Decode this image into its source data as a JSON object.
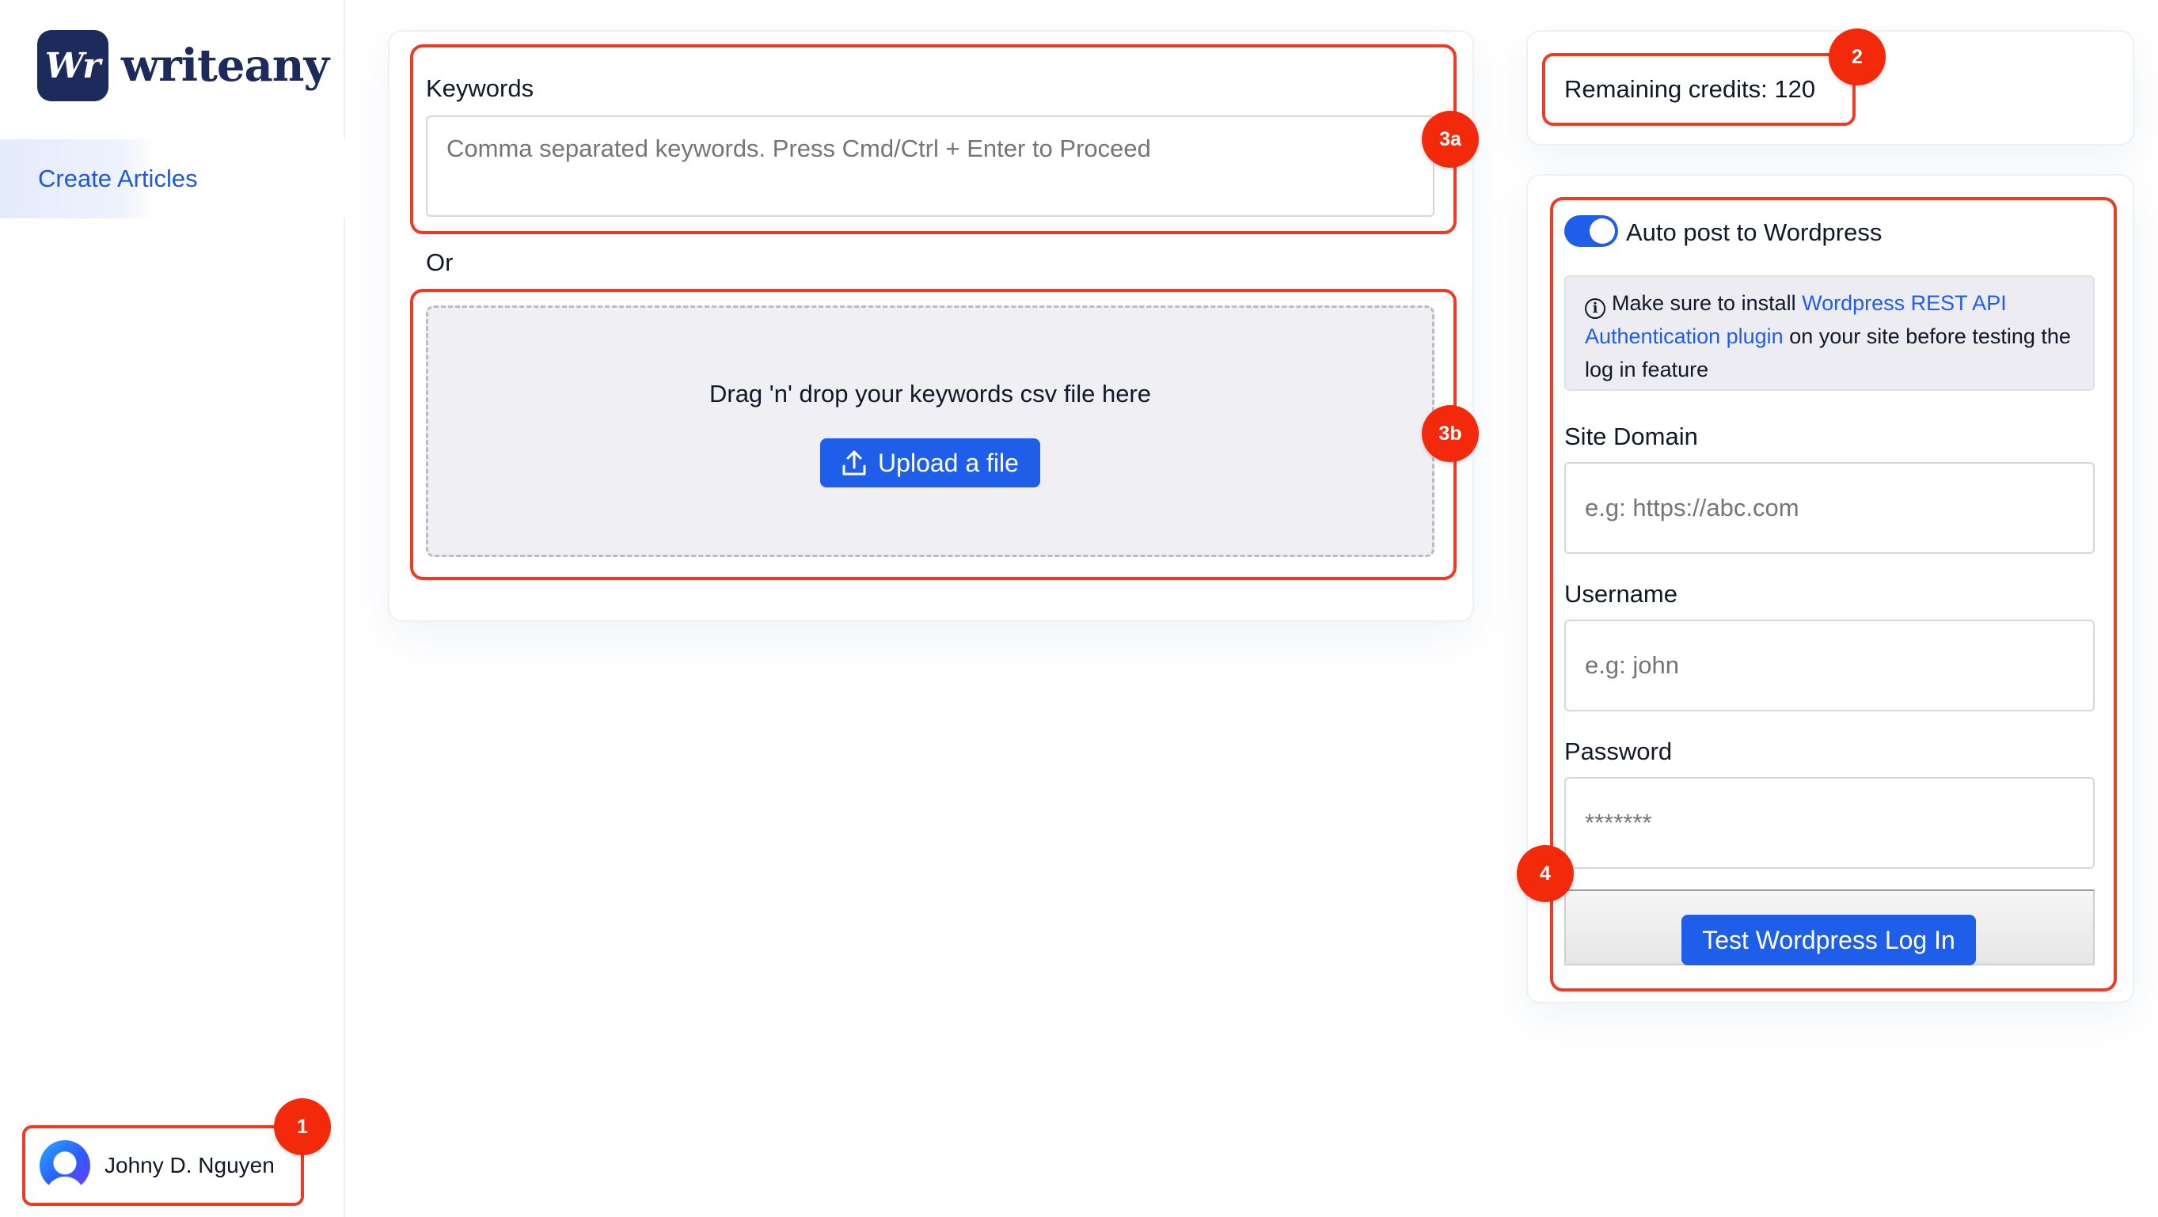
{
  "brand": {
    "mark": "Wr",
    "name": "writeany"
  },
  "sidebar": {
    "nav": [
      {
        "label": "Create Articles"
      }
    ]
  },
  "user": {
    "name": "Johny D. Nguyen"
  },
  "badges": {
    "user": "1",
    "credits": "2",
    "keywords": "3a",
    "upload": "3b",
    "wordpress": "4"
  },
  "keywords": {
    "label": "Keywords",
    "placeholder": "Comma separated keywords. Press Cmd/Ctrl + Enter to Proceed",
    "or_label": "Or"
  },
  "upload": {
    "drop_text": "Drag 'n' drop your keywords csv file here",
    "button_label": "Upload a file"
  },
  "credits": {
    "text": "Remaining credits: 120"
  },
  "wordpress": {
    "toggle_label": "Auto post to Wordpress",
    "toggle_on": true,
    "info_prefix": "Make sure to install ",
    "info_link": "Wordpress REST API Authentication plugin",
    "info_suffix": " on your site before testing the log in feature",
    "site_domain_label": "Site Domain",
    "site_domain_placeholder": "e.g: https://abc.com",
    "username_label": "Username",
    "username_placeholder": "e.g: john",
    "password_label": "Password",
    "password_placeholder": "*******",
    "test_button_label": "Test Wordpress Log In"
  },
  "colors": {
    "accent": "#1e5ee8",
    "highlight": "#ef3b24",
    "badge": "#f22a0b",
    "brand": "#1c2a5c"
  }
}
